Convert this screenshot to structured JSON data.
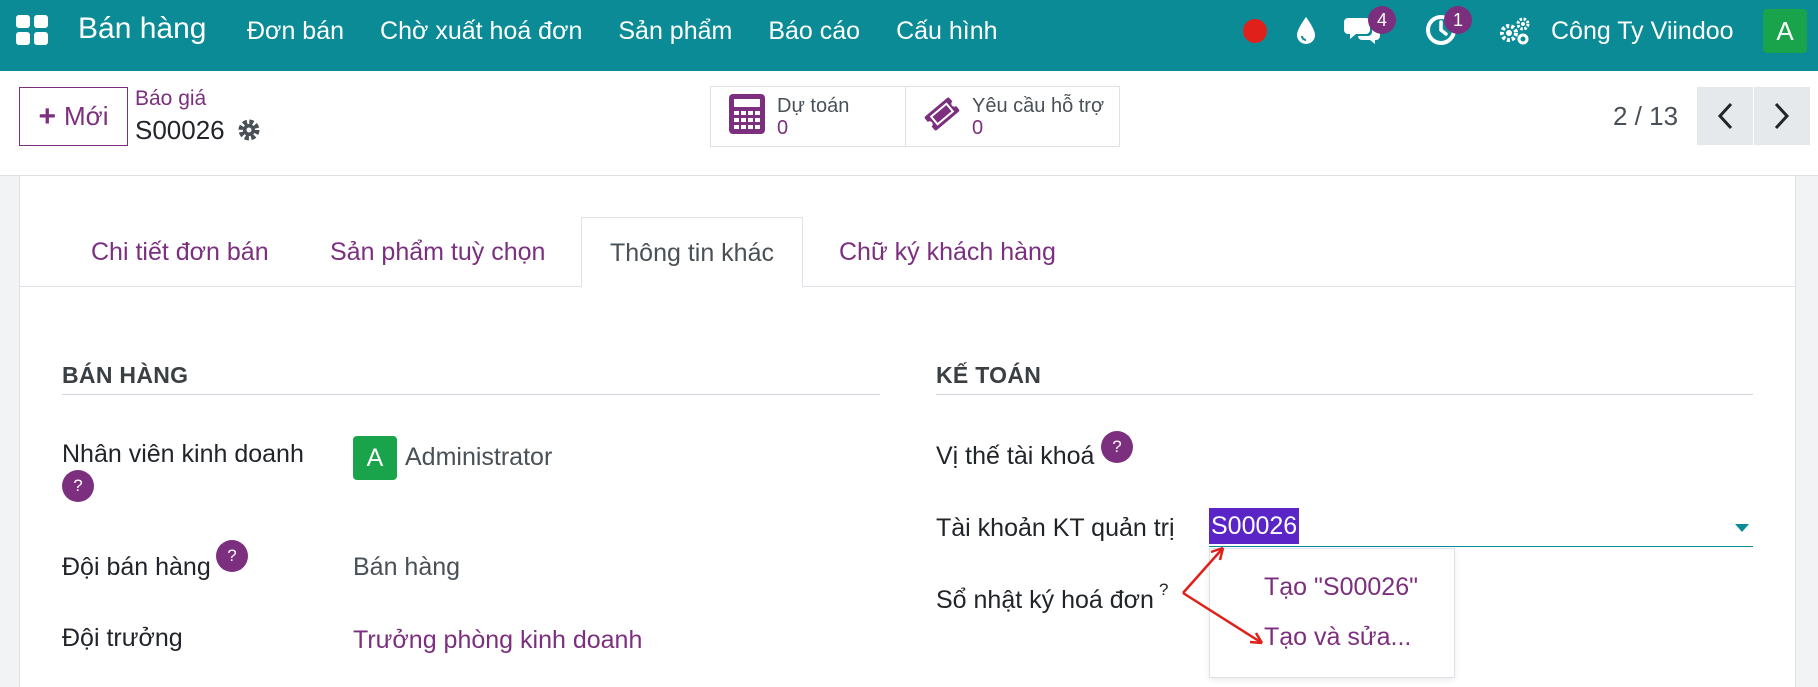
{
  "navbar": {
    "brand": "Bán hàng",
    "menu": [
      "Đơn bán",
      "Chờ xuất hoá đơn",
      "Sản phẩm",
      "Báo cáo",
      "Cấu hình"
    ],
    "chat_badge": "4",
    "activity_badge": "1",
    "company": "Công Ty Viindoo",
    "avatar_letter": "A"
  },
  "control": {
    "new_label": "Mới",
    "breadcrumb_parent": "Báo giá",
    "record_name": "S00026",
    "smart_buttons": [
      {
        "label": "Dự toán",
        "value": "0",
        "icon": "calculator-icon"
      },
      {
        "label": "Yêu cầu hỗ trợ",
        "value": "0",
        "icon": "ticket-icon"
      }
    ],
    "pager": "2 / 13"
  },
  "tabs": [
    "Chi tiết đơn bán",
    "Sản phẩm tuỳ chọn",
    "Thông tin khác",
    "Chữ ký khách hàng"
  ],
  "active_tab": "Thông tin khác",
  "sales_group": {
    "title": "BÁN HÀNG",
    "salesperson_label": "Nhân viên kinh doanh",
    "salesperson_avatar": "A",
    "salesperson_value": "Administrator",
    "team_label": "Đội bán hàng",
    "team_value": "Bán hàng",
    "leader_label": "Đội trưởng",
    "leader_value": "Trưởng phòng kinh doanh"
  },
  "accounting_group": {
    "title": "KẾ TOÁN",
    "fiscal_label": "Vị thế tài khoá",
    "analytic_label": "Tài khoản KT quản trị",
    "analytic_value": "S00026",
    "journal_label": "Sổ nhật ký hoá đơn",
    "journal_help": "?"
  },
  "help_mark": "?",
  "dropdown": {
    "create": "Tạo \"S00026\"",
    "create_edit": "Tạo và sửa..."
  },
  "colors": {
    "navbar": "#0b8b96",
    "accent": "#7b2f7e",
    "avatar": "#19a34a",
    "selection": "#5a24c7",
    "arrow": "#e0201b"
  }
}
